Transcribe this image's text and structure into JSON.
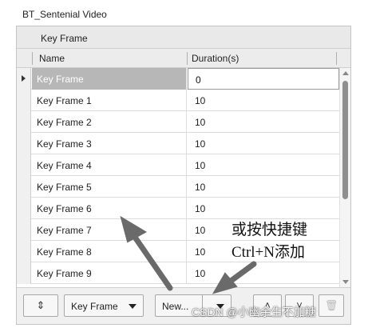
{
  "panel_title": "BT_Sentenial Video",
  "group_header": "Key Frame",
  "columns": {
    "name": "Name",
    "duration": "Duration(s)"
  },
  "rows": [
    {
      "name": "Key Frame",
      "duration": "0",
      "selected": true
    },
    {
      "name": "Key Frame 1",
      "duration": "10"
    },
    {
      "name": "Key Frame 2",
      "duration": "10"
    },
    {
      "name": "Key Frame 3",
      "duration": "10"
    },
    {
      "name": "Key Frame 4",
      "duration": "10"
    },
    {
      "name": "Key Frame 5",
      "duration": "10"
    },
    {
      "name": "Key Frame 6",
      "duration": "10"
    },
    {
      "name": "Key Frame 7",
      "duration": "10"
    },
    {
      "name": "Key Frame 8",
      "duration": "10"
    },
    {
      "name": "Key Frame 9",
      "duration": "10"
    }
  ],
  "toolbar": {
    "swap_icon": "swap-vertical-icon",
    "type_select": "Key Frame",
    "new_label": "New...",
    "move_up_icon": "chevron-up-icon",
    "move_down_icon": "chevron-down-icon",
    "delete_icon": "trash-icon"
  },
  "annotation": {
    "line1": "或按快捷键",
    "line2": "Ctrl+N添加"
  },
  "watermark": "CSDN @小幽余生不加糖",
  "colors": {
    "selected_row": "#b7b7b7",
    "arrow": "#6a6a6a"
  }
}
